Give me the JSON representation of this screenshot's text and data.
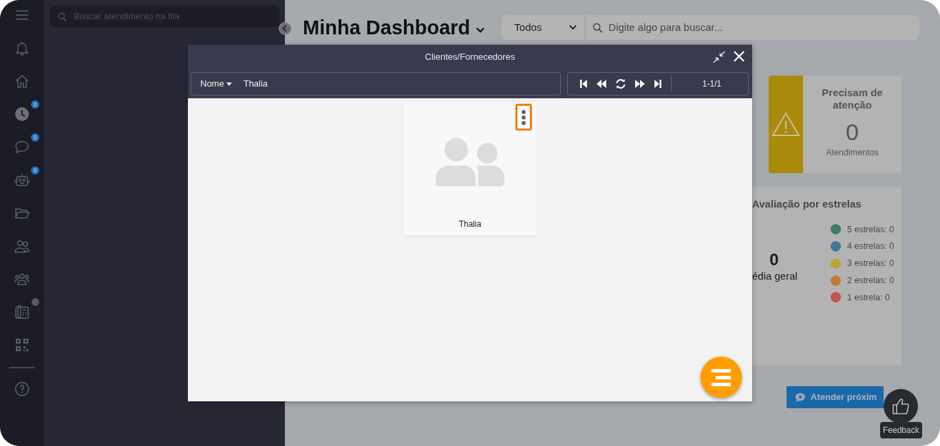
{
  "sidebar": {
    "items": [
      {
        "indicator": false
      },
      {
        "indicator": false
      },
      {
        "indicator": false
      },
      {
        "badge": "0",
        "indicator": false
      },
      {
        "badge": "0",
        "indicator": false
      },
      {
        "badge": "0",
        "indicator": false
      },
      {
        "indicator": false
      },
      {
        "indicator": false
      },
      {
        "indicator": false
      },
      {
        "indicator": true
      },
      {
        "indicator": false
      },
      {
        "indicator": false
      }
    ]
  },
  "queue_search": {
    "placeholder": "Buscar atendimento na fila"
  },
  "header": {
    "title": "Minha Dashboard",
    "filter": "Todos",
    "search_placeholder": "Digite algo para buscar..."
  },
  "attention_card": {
    "title": "Precisam de atenção",
    "count": "0",
    "caption": "Atendimentos"
  },
  "rating_card": {
    "title": "Avaliação por estrelas",
    "average": "0",
    "average_label": "édia geral",
    "legend": [
      {
        "label": "5 estrelas: 0",
        "color": "#3a7d6e"
      },
      {
        "label": "4 estrelas: 0",
        "color": "#3d789c"
      },
      {
        "label": "3 estrelas: 0",
        "color": "#bba434"
      },
      {
        "label": "2 estrelas: 0",
        "color": "#c27b36"
      },
      {
        "label": "1 estrela: 0",
        "color": "#c0544f"
      }
    ]
  },
  "next_button": "Atender próxim",
  "feedback": "Feedback",
  "modal": {
    "title": "Clientes/Fornecedores",
    "field": "Nome",
    "query": "Thalia",
    "range": "1-1/1",
    "results": [
      {
        "name": "Thalia",
        "highlighted": true
      }
    ]
  }
}
